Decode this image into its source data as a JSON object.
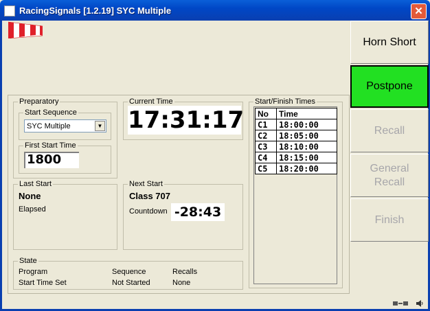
{
  "window": {
    "title": "RacingSignals [1.2.19] SYC Multiple",
    "close_glyph": "✕"
  },
  "preparatory": {
    "title": "Preparatory",
    "start_sequence_label": "Start Sequence",
    "start_sequence_value": "SYC Multiple",
    "first_start_label": "First Start Time",
    "first_start_value": "1800"
  },
  "current_time": {
    "title": "Current Time",
    "value": "17:31:17"
  },
  "last_start": {
    "title": "Last Start",
    "value": "None",
    "elapsed_label": "Elapsed"
  },
  "next_start": {
    "title": "Next Start",
    "value": "Class 707",
    "countdown_label": "Countdown",
    "countdown_value": "-28:43"
  },
  "state": {
    "title": "State",
    "program_label": "Program",
    "program_value": "Start Time Set",
    "sequence_label": "Sequence",
    "sequence_value": "Not Started",
    "recalls_label": "Recalls",
    "recalls_value": "None"
  },
  "start_finish": {
    "title": "Start/Finish Times",
    "headers": [
      "No",
      "Time"
    ],
    "rows": [
      [
        "C1",
        "18:00:00"
      ],
      [
        "C2",
        "18:05:00"
      ],
      [
        "C3",
        "18:10:00"
      ],
      [
        "C4",
        "18:15:00"
      ],
      [
        "C5",
        "18:20:00"
      ]
    ]
  },
  "buttons": {
    "horn_short": "Horn Short",
    "postpone": "Postpone",
    "recall": "Recall",
    "general_recall": "General Recall",
    "finish": "Finish"
  },
  "colors": {
    "postpone_active": "#22e022",
    "title_bar": "#0047c6",
    "flag_red": "#e0202a"
  },
  "icons": {
    "app": "app-icon",
    "flag": "flag-icon",
    "connection": "connection-icon",
    "speaker": "speaker-icon"
  }
}
